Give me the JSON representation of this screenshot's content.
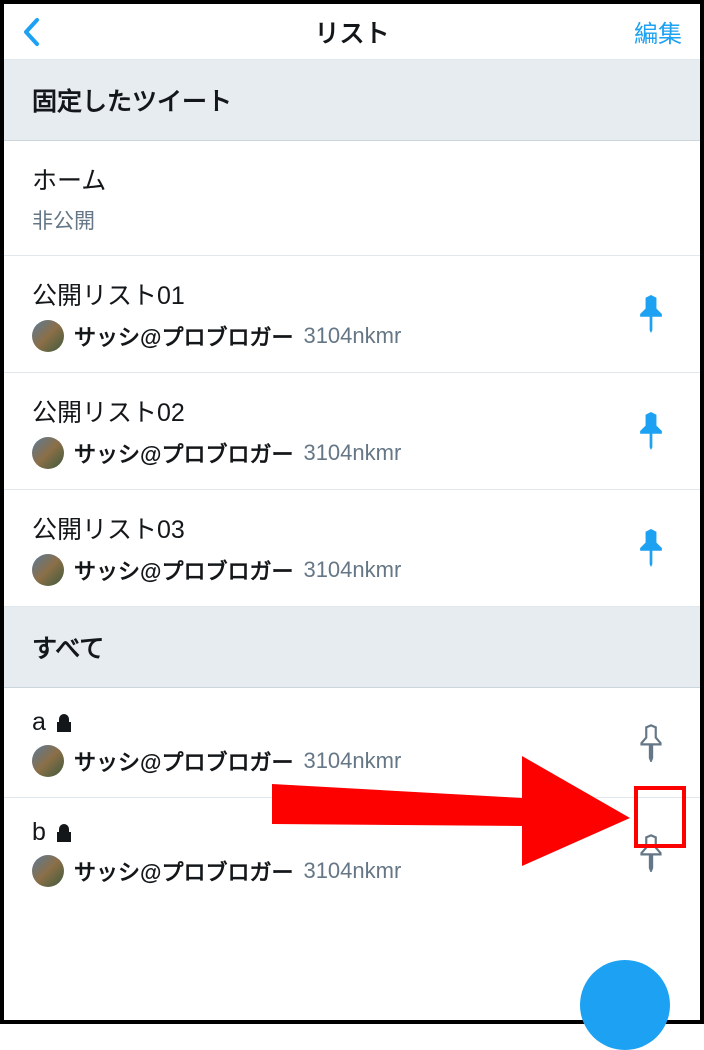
{
  "nav": {
    "title": "リスト",
    "edit": "編集"
  },
  "sections": {
    "pinned": "固定したツイート",
    "all": "すべて"
  },
  "home": {
    "title": "ホーム",
    "privacy": "非公開"
  },
  "pinned_lists": [
    {
      "title": "公開リスト01",
      "author": "サッシ@プロブロガー",
      "handle": "3104nkmr"
    },
    {
      "title": "公開リスト02",
      "author": "サッシ@プロブロガー",
      "handle": "3104nkmr"
    },
    {
      "title": "公開リスト03",
      "author": "サッシ@プロブロガー",
      "handle": "3104nkmr"
    }
  ],
  "all_lists": [
    {
      "title": "a",
      "author": "サッシ@プロブロガー",
      "handle": "3104nkmr"
    },
    {
      "title": "b",
      "author": "サッシ@プロブロガー",
      "handle": "3104nkmr"
    }
  ]
}
